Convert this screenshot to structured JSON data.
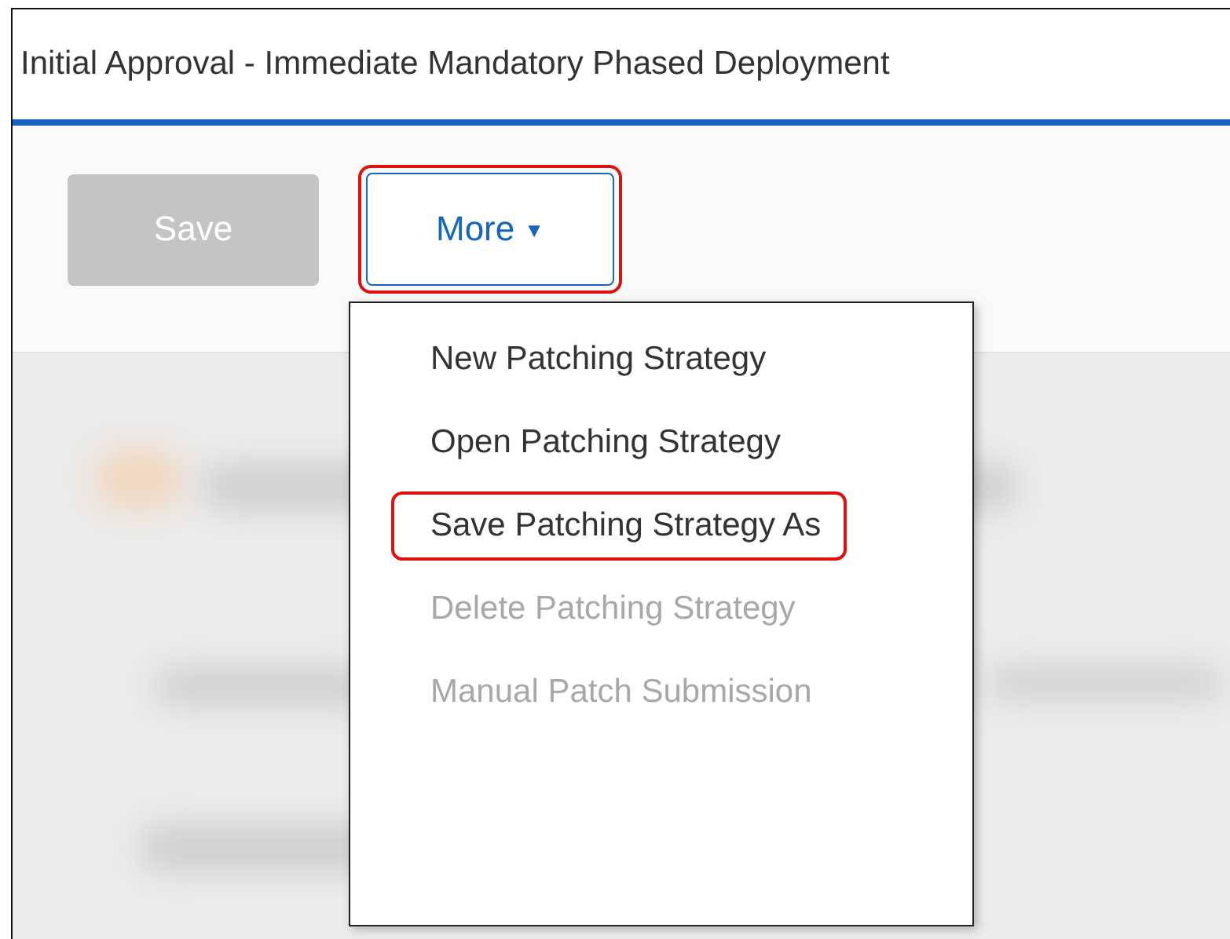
{
  "header": {
    "title": "Initial Approval - Immediate Mandatory Phased Deployment"
  },
  "toolbar": {
    "buttons": [
      {
        "label": "Save",
        "disabled": true,
        "highlighted": false
      },
      {
        "label": "More",
        "disabled": false,
        "highlighted": true,
        "caret": "▼"
      }
    ]
  },
  "menu": {
    "items": [
      {
        "label": "New Patching Strategy",
        "disabled": false,
        "highlighted": false
      },
      {
        "label": "Open Patching Strategy",
        "disabled": false,
        "highlighted": false
      },
      {
        "label": "Save Patching Strategy As",
        "disabled": false,
        "highlighted": true
      },
      {
        "label": "Delete Patching Strategy",
        "disabled": true,
        "highlighted": false
      },
      {
        "label": "Manual Patch Submission",
        "disabled": true,
        "highlighted": false
      }
    ]
  }
}
